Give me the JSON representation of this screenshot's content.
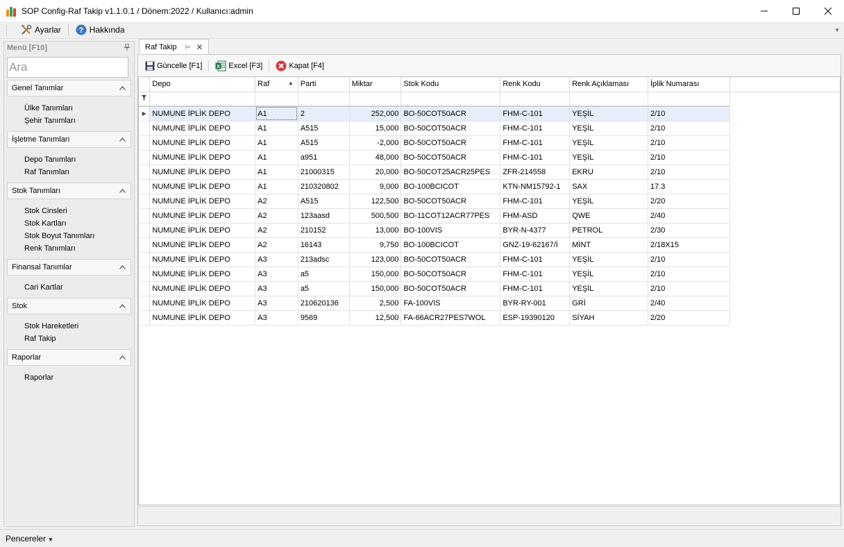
{
  "window": {
    "title": "SOP Config-Raf Takip v1.1.0.1 / Dönem:2022 / Kullanıcı:admin",
    "logo_colors": [
      "#f08a24",
      "#2aa84a",
      "#e53935"
    ]
  },
  "menubar": {
    "settings_label": "Ayarlar",
    "settings_icon": "tools-icon",
    "about_label": "Hakkında",
    "about_icon": "help-icon"
  },
  "sidemenu": {
    "header": "Menü [F10]",
    "search_placeholder": "Ara",
    "groups": [
      {
        "title": "Genel Tanımlar",
        "items": [
          "Ülke Tanımları",
          "Şehir Tanımları"
        ]
      },
      {
        "title": "İşletme Tanımları",
        "items": [
          "Depo Tanımları",
          "Raf Tanımları"
        ]
      },
      {
        "title": "Stok Tanımları",
        "items": [
          "Stok Cinsleri",
          "Stok Kartları",
          "Stok Boyut Tanımları",
          "Renk Tanımları"
        ]
      },
      {
        "title": "Finansal Tanımlar",
        "items": [
          "Cari Kartlar"
        ]
      },
      {
        "title": "Stok",
        "items": [
          "Stok Hareketleri",
          "Raf Takip"
        ]
      },
      {
        "title": "Raporlar",
        "items": [
          "Raporlar"
        ]
      }
    ]
  },
  "doc_tab": {
    "label": "Raf Takip"
  },
  "actions": {
    "refresh_label": "Güncelle [F1]",
    "excel_label": "Excel [F3]",
    "close_label": "Kapat [F4]"
  },
  "grid": {
    "columns": [
      "Depo",
      "Raf",
      "Parti",
      "Miktar",
      "Stok Kodu",
      "Renk Kodu",
      "Renk Açıklaması",
      "İplik Numarası"
    ],
    "sorted_column": "Raf",
    "rows": [
      [
        "NUMUNE İPLİK DEPO",
        "A1",
        "2",
        "252,000",
        "BO-50COT50ACR",
        "FHM-C-101",
        "YEŞİL",
        "2/10"
      ],
      [
        "NUMUNE İPLİK DEPO",
        "A1",
        "A515",
        "15,000",
        "BO-50COT50ACR",
        "FHM-C-101",
        "YEŞİL",
        "2/10"
      ],
      [
        "NUMUNE İPLİK DEPO",
        "A1",
        "A515",
        "-2,000",
        "BO-50COT50ACR",
        "FHM-C-101",
        "YEŞİL",
        "2/10"
      ],
      [
        "NUMUNE İPLİK DEPO",
        "A1",
        "a951",
        "48,000",
        "BO-50COT50ACR",
        "FHM-C-101",
        "YEŞİL",
        "2/10"
      ],
      [
        "NUMUNE İPLİK DEPO",
        "A1",
        "21000315",
        "20,000",
        "BO-50COT25ACR25PES",
        "ZFR-214558",
        "EKRU",
        "2/10"
      ],
      [
        "NUMUNE İPLİK DEPO",
        "A1",
        "210320802",
        "9,000",
        "BO-100BCICOT",
        "KTN-NM15792-1",
        "SAX",
        "17.3"
      ],
      [
        "NUMUNE İPLİK DEPO",
        "A2",
        "A515",
        "122,500",
        "BO-50COT50ACR",
        "FHM-C-101",
        "YEŞİL",
        "2/20"
      ],
      [
        "NUMUNE İPLİK DEPO",
        "A2",
        "123aasd",
        "500,500",
        "BO-11COT12ACR77PES",
        "FHM-ASD",
        "QWE",
        "2/40"
      ],
      [
        "NUMUNE İPLİK DEPO",
        "A2",
        "210152",
        "13,000",
        "BO-100VIS",
        "BYR-N-4377",
        "PETROL",
        "2/30"
      ],
      [
        "NUMUNE İPLİK DEPO",
        "A2",
        "16143",
        "9,750",
        "BO-100BCICOT",
        "GNZ-19-62167/İ",
        "MİNT",
        "2/18X15"
      ],
      [
        "NUMUNE İPLİK DEPO",
        "A3",
        "213adsc",
        "123,000",
        "BO-50COT50ACR",
        "FHM-C-101",
        "YEŞİL",
        "2/10"
      ],
      [
        "NUMUNE İPLİK DEPO",
        "A3",
        "a5",
        "150,000",
        "BO-50COT50ACR",
        "FHM-C-101",
        "YEŞİL",
        "2/10"
      ],
      [
        "NUMUNE İPLİK DEPO",
        "A3",
        "a5",
        "150,000",
        "BO-50COT50ACR",
        "FHM-C-101",
        "YEŞİL",
        "2/10"
      ],
      [
        "NUMUNE İPLİK DEPO",
        "A3",
        "210620136",
        "2,500",
        "FA-100VIS",
        "BYR-RY-001",
        "GRİ",
        "2/40"
      ],
      [
        "NUMUNE İPLİK DEPO",
        "A3",
        "9569",
        "12,500",
        "FA-66ACR27PES7WOL",
        "ESP-19390120",
        "SİYAH",
        "2/20"
      ]
    ]
  },
  "statusbar": {
    "windows_label": "Pencereler"
  },
  "colors": {
    "selected_row": "#e7eefa",
    "excel_green": "#1e7145",
    "close_red": "#d9363e",
    "help_blue": "#3a78c2"
  }
}
